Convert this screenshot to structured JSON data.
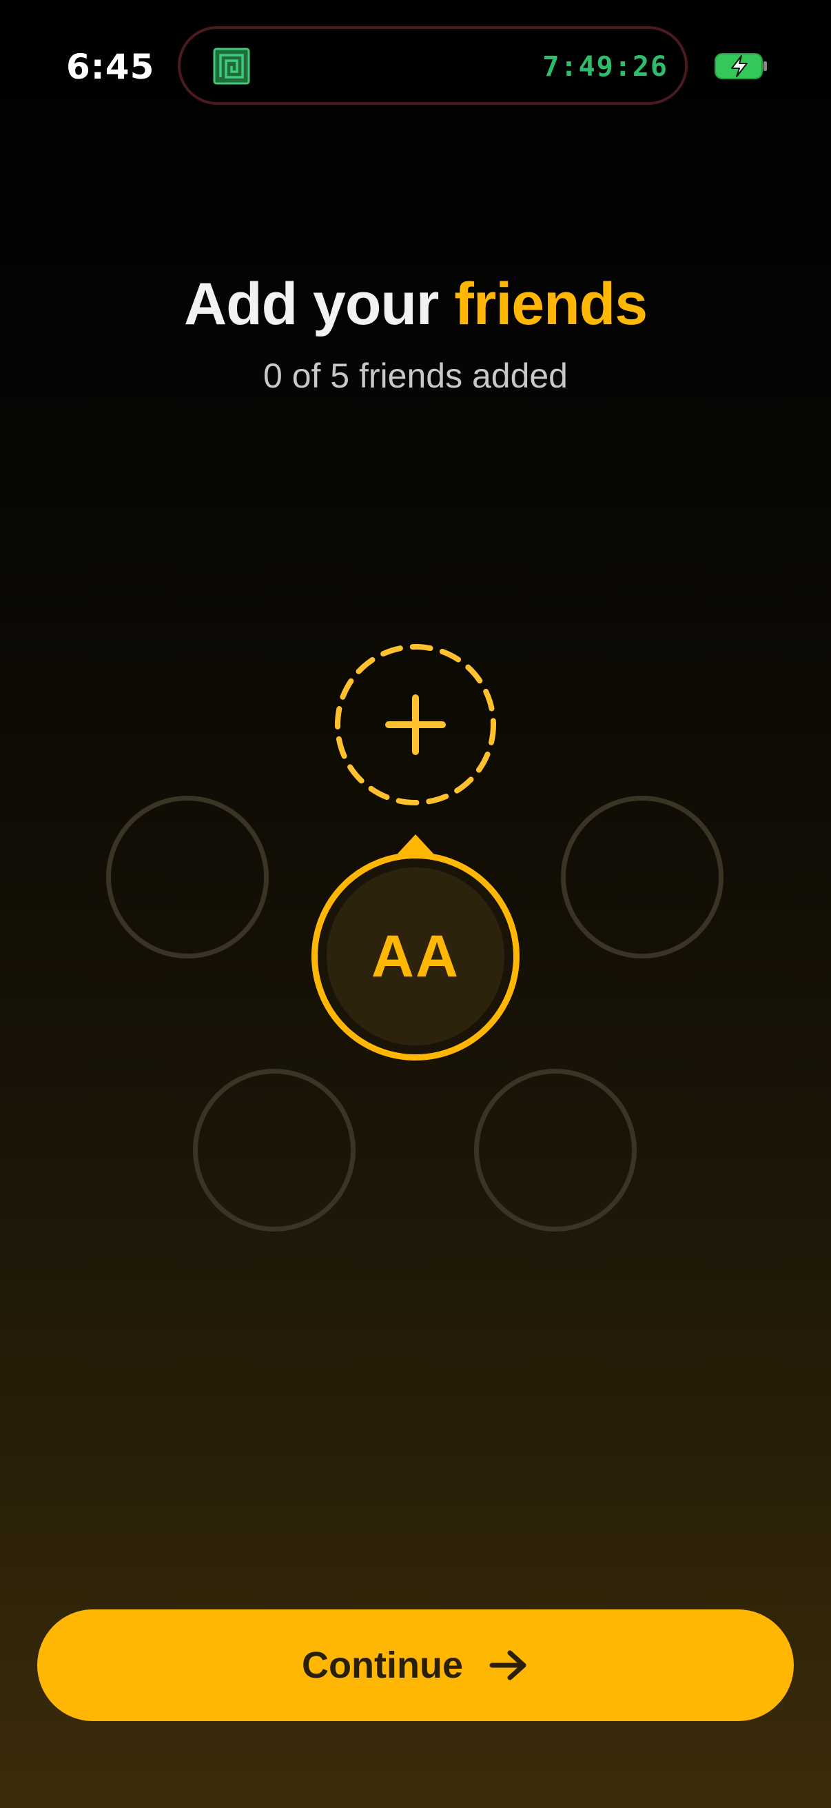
{
  "status_bar": {
    "time": "6:45",
    "island_timer": "7:49:26",
    "island_icon": "spiral-app-icon",
    "battery_icon": "battery-charging-icon"
  },
  "header": {
    "title_part1": "Add your ",
    "title_part2": "friends",
    "subtitle": "0 of 5 friends added"
  },
  "friends": {
    "added": 0,
    "total": 5,
    "me_initials": "AA",
    "add_icon": "plus-icon"
  },
  "footer": {
    "continue_label": "Continue",
    "continue_icon": "arrow-right-icon"
  },
  "colors": {
    "accent": "#ffb703",
    "timer_green": "#2ebd6b",
    "empty_slot": "#3a3424"
  }
}
